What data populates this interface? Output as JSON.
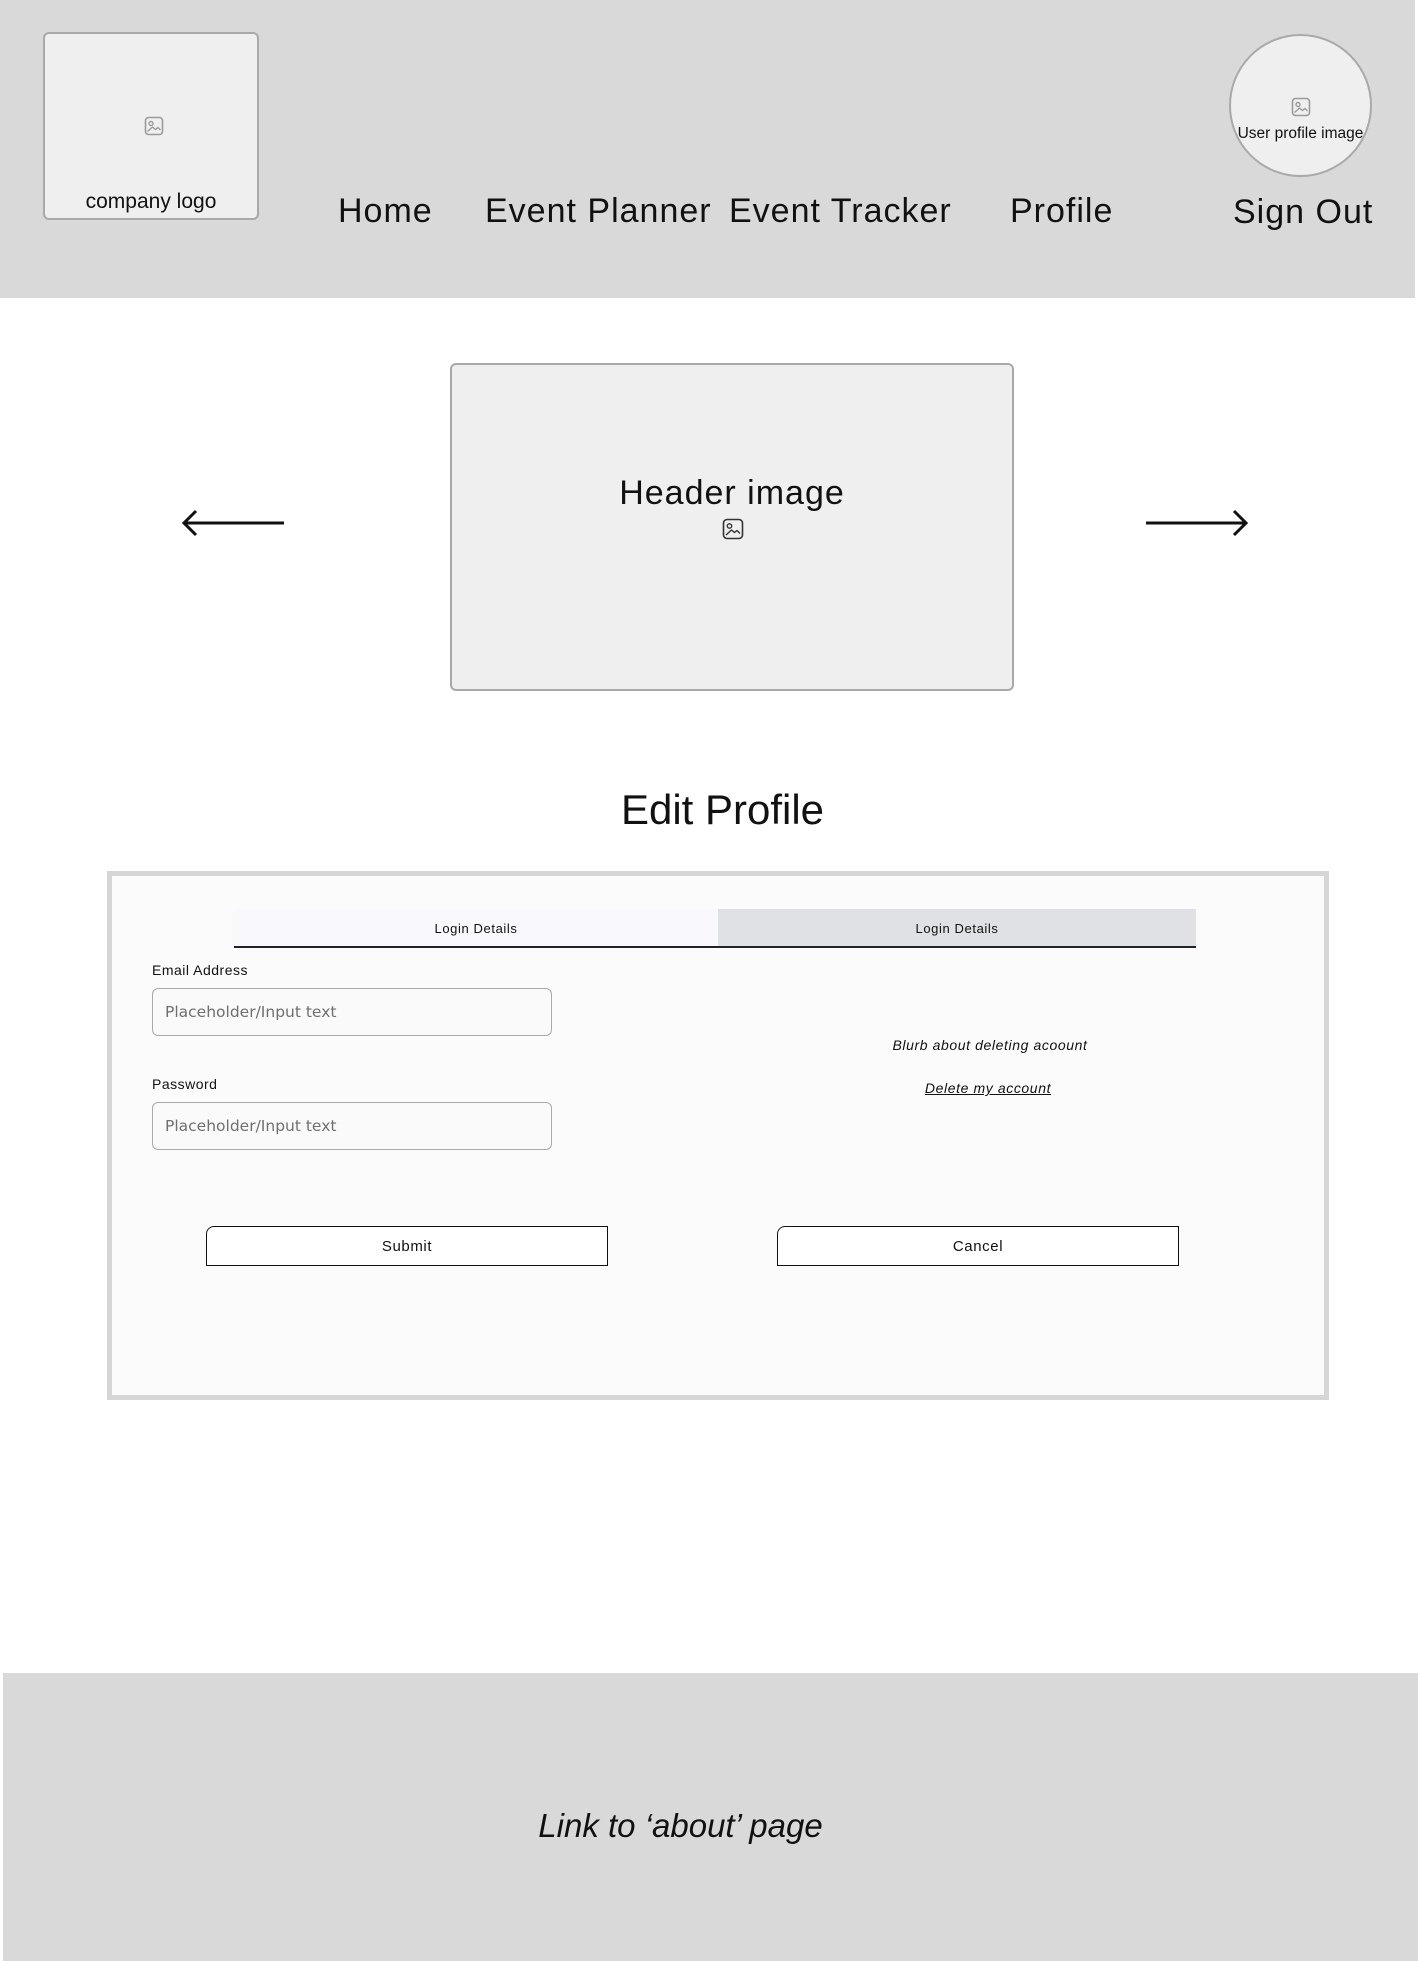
{
  "header": {
    "logo_label": "company logo",
    "nav": {
      "home": "Home",
      "event_planner": "Event Planner",
      "event_tracker": "Event Tracker",
      "profile": "Profile",
      "sign_out": "Sign Out"
    },
    "avatar_label": "User profile image"
  },
  "hero": {
    "label": "Header image"
  },
  "edit_profile": {
    "title": "Edit Profile",
    "tabs": [
      "Login Details",
      "Login Details"
    ],
    "email": {
      "label": "Email Address",
      "placeholder": "Placeholder/Input text"
    },
    "password": {
      "label": "Password",
      "placeholder": "Placeholder/Input text"
    },
    "delete_blurb": "Blurb about deleting acoount",
    "delete_link": "Delete my account",
    "submit_label": "Submit",
    "cancel_label": "Cancel"
  },
  "footer": {
    "about_link": "Link to ‘about’ page"
  },
  "colors": {
    "bar_background": "#d9d9d9",
    "placeholder_box": "#efefef",
    "panel_background": "#fbfbfb",
    "active_tab": "#dfe1e5"
  },
  "icons": [
    "image-placeholder-icon",
    "arrow-left-icon",
    "arrow-right-icon"
  ]
}
